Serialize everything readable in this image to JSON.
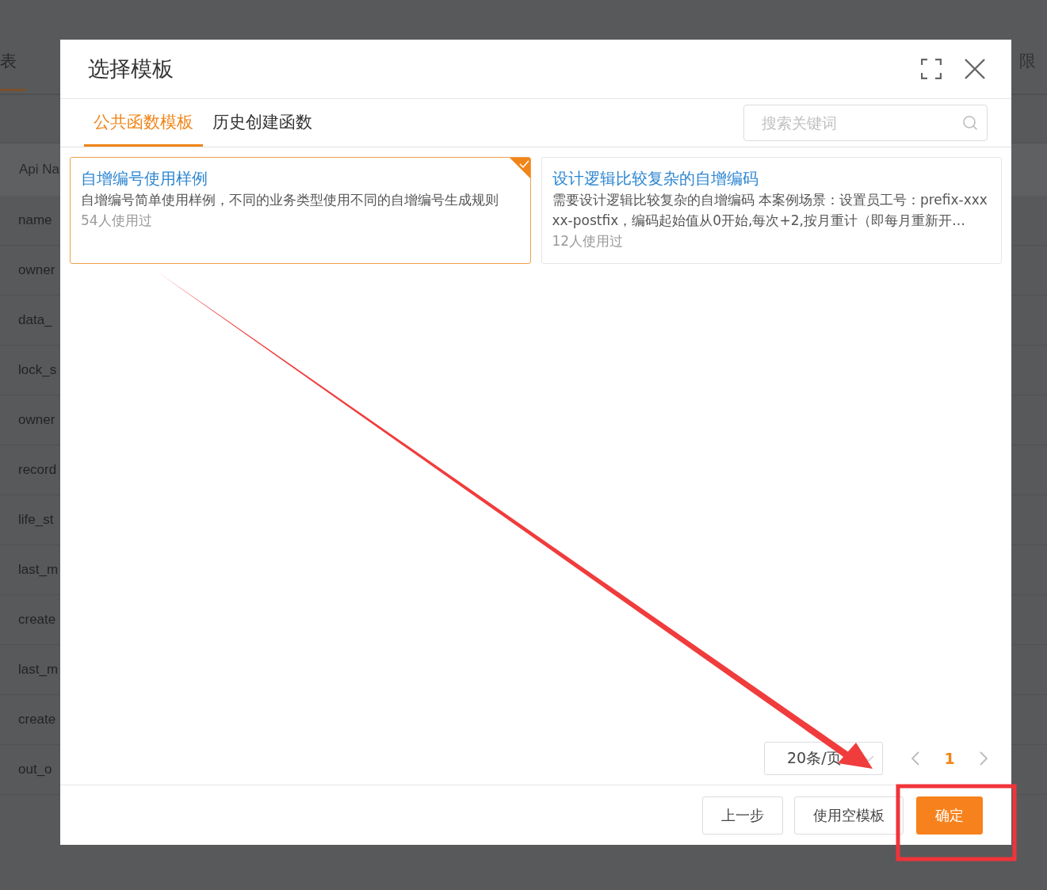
{
  "background_page": {
    "tabs": [
      {
        "label": "表",
        "selected": true
      },
      {
        "label": "限",
        "selected": false
      }
    ],
    "table": {
      "columns": [
        "Api Na"
      ],
      "rows": [
        "name",
        "owner",
        "data_",
        "lock_s",
        "owner",
        "record",
        "life_st",
        "last_m",
        "create",
        "last_m",
        "create",
        "out_o"
      ]
    }
  },
  "dialog": {
    "title": "选择模板",
    "tabs": [
      {
        "label": "公共函数模板",
        "selected": true
      },
      {
        "label": "历史创建函数",
        "selected": false
      }
    ],
    "search": {
      "placeholder": "搜索关键词"
    },
    "templates": [
      {
        "title": "自增编号使用样例",
        "description": "自增编号简单使用样例，不同的业务类型使用不同的自增编号生成规则",
        "usage": "54人使用过",
        "selected": true
      },
      {
        "title": "设计逻辑比较复杂的自增编码",
        "description": "需要设计逻辑比较复杂的自增编码 本案例场景：设置员工号：prefix-xxxxx-postfix，编码起始值从0开始,每次+2,按月重计（即每月重新开…",
        "usage": "12人使用过",
        "selected": false
      }
    ],
    "pagination": {
      "page_size": "20条/页",
      "pages": [
        {
          "label": "1",
          "selected": true
        }
      ]
    },
    "buttons": [
      {
        "label": "上一步",
        "kind": "default"
      },
      {
        "label": "使用空模板",
        "kind": "default"
      },
      {
        "label": "确定",
        "kind": "primary"
      }
    ]
  }
}
